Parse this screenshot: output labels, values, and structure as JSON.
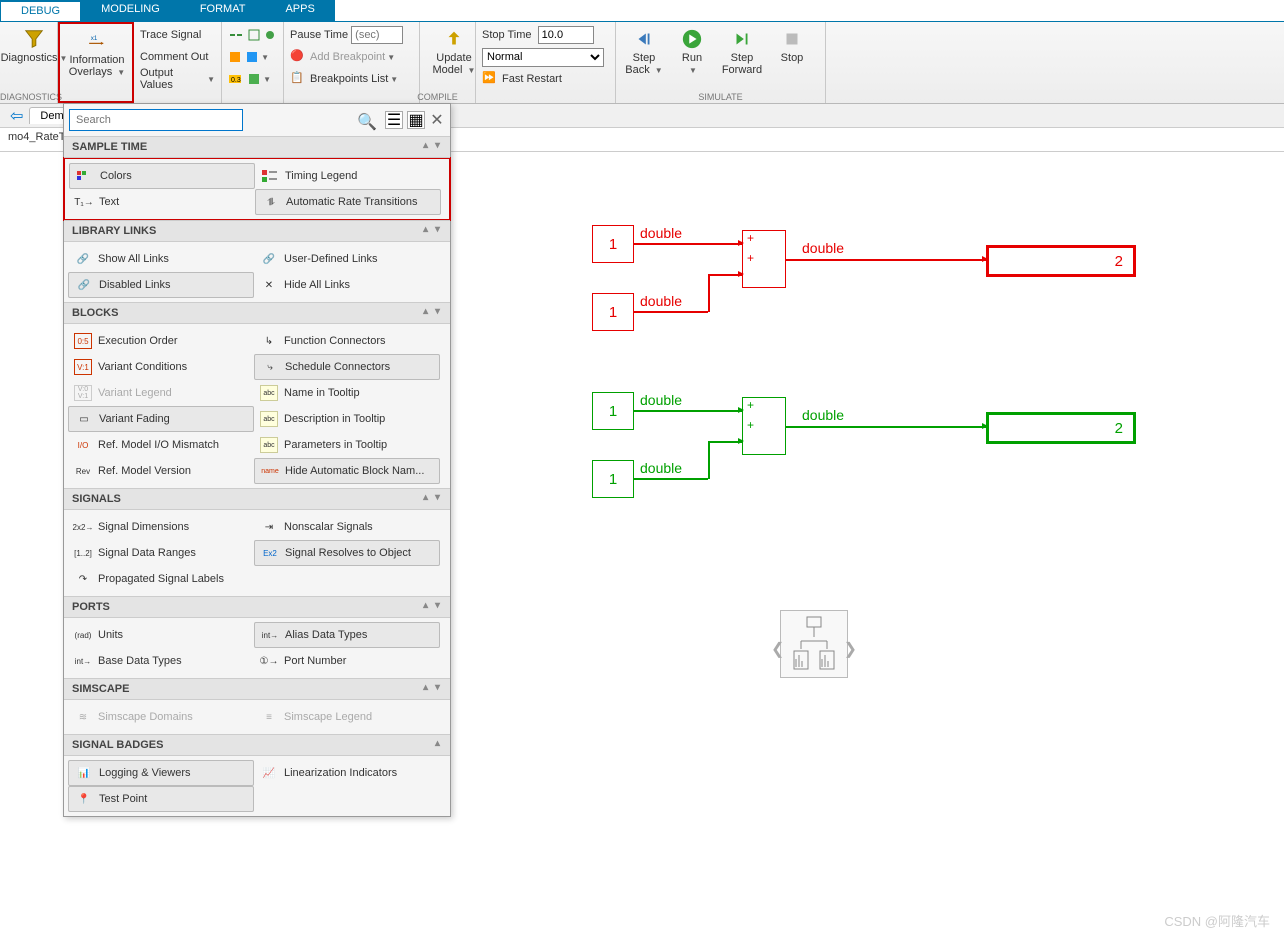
{
  "tabs": {
    "debug": "DEBUG",
    "modeling": "MODELING",
    "format": "FORMAT",
    "apps": "APPS"
  },
  "ribbon": {
    "diagnostics": "Diagnostics",
    "info_overlays_l1": "Information",
    "info_overlays_l2": "Overlays",
    "trace": "Trace Signal",
    "comment": "Comment Out",
    "outputv": "Output Values",
    "pausetime_lbl": "Pause Time",
    "pausetime_ph": "(sec)",
    "addbp": "Add Breakpoint",
    "bplist": "Breakpoints List",
    "update_l1": "Update",
    "update_l2": "Model",
    "stoptime_lbl": "Stop Time",
    "stoptime_val": "10.0",
    "mode": "Normal",
    "fastrestart": "Fast Restart",
    "stepback_l1": "Step",
    "stepback_l2": "Back",
    "run": "Run",
    "stepfwd_l1": "Step",
    "stepfwd_l2": "Forward",
    "stop": "Stop",
    "g_diag": "DIAGNOSTICS",
    "g_compile": "COMPILE",
    "g_sim": "SIMULATE"
  },
  "file": {
    "tab": "Demo",
    "crumb": "mo4_RateT"
  },
  "panel": {
    "search_ph": "Search",
    "s_sampletime": "SAMPLE TIME",
    "colors": "Colors",
    "text": "Text",
    "timing": "Timing Legend",
    "auto": "Automatic Rate Transitions",
    "s_lib": "LIBRARY LINKS",
    "showall": "Show All Links",
    "userdef": "User-Defined Links",
    "disabled": "Disabled Links",
    "hideall": "Hide All Links",
    "s_blocks": "BLOCKS",
    "exec": "Execution Order",
    "func": "Function Connectors",
    "varcond": "Variant Conditions",
    "sched": "Schedule Connectors",
    "varleg": "Variant Legend",
    "nametip": "Name in Tooltip",
    "varfade": "Variant Fading",
    "desctip": "Description in Tooltip",
    "refio": "Ref. Model I/O Mismatch",
    "paramtip": "Parameters in Tooltip",
    "refver": "Ref. Model Version",
    "hideauto": "Hide Automatic Block Nam...",
    "s_signals": "SIGNALS",
    "sigdim": "Signal Dimensions",
    "nonsc": "Nonscalar Signals",
    "sigrange": "Signal Data Ranges",
    "sigres": "Signal Resolves to Object",
    "proplab": "Propagated Signal Labels",
    "s_ports": "PORTS",
    "units": "Units",
    "alias": "Alias Data Types",
    "basedt": "Base Data Types",
    "portnum": "Port Number",
    "s_simscape": "SIMSCAPE",
    "simdom": "Simscape Domains",
    "simleg": "Simscape Legend",
    "s_badges": "SIGNAL BADGES",
    "logview": "Logging & Viewers",
    "linind": "Linearization Indicators",
    "testpt": "Test Point"
  },
  "diagram": {
    "const": "1",
    "double": "double",
    "out": "2"
  },
  "watermark": "CSDN @阿隆汽车"
}
